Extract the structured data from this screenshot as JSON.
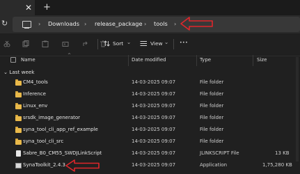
{
  "tab": {
    "close": "✕",
    "add": "+"
  },
  "nav": {
    "refresh": "↻",
    "sep": "›",
    "breadcrumbs": [
      "Downloads",
      "release_package",
      "tools"
    ]
  },
  "toolbar": {
    "sort": "Sort",
    "view": "View",
    "more": "•••",
    "chevron": "⌄"
  },
  "columns": {
    "name": "Name",
    "date": "Date modified",
    "type": "Type",
    "size": "Size"
  },
  "group": {
    "label": "Last week",
    "chevron": "⌄"
  },
  "rows": [
    {
      "name": "CM4_tools",
      "date": "14-03-2025 09:07",
      "type": "File folder",
      "size": ""
    },
    {
      "name": "Inference",
      "date": "14-03-2025 09:07",
      "type": "File folder",
      "size": ""
    },
    {
      "name": "Linux_env",
      "date": "14-03-2025 09:07",
      "type": "File folder",
      "size": ""
    },
    {
      "name": "srsdk_image_generator",
      "date": "14-03-2025 09:07",
      "type": "File folder",
      "size": ""
    },
    {
      "name": "syna_tool_cli_app_ref_example",
      "date": "14-03-2025 09:07",
      "type": "File folder",
      "size": ""
    },
    {
      "name": "syna_tool_cli_src",
      "date": "14-03-2025 09:07",
      "type": "File folder",
      "size": ""
    },
    {
      "name": "Sabre_B0_CM55_SWDJLinkScript",
      "date": "14-03-2025 09:07",
      "type": "JLINKSCRIPT File",
      "size": "13 KB"
    },
    {
      "name": "SynaToolkit_2.4.3",
      "date": "14-03-2025 09:07",
      "type": "Application",
      "size": "1,75,280 KB"
    }
  ],
  "colors": {
    "annotation": "#e0262b",
    "folder": "#e9b94a"
  }
}
